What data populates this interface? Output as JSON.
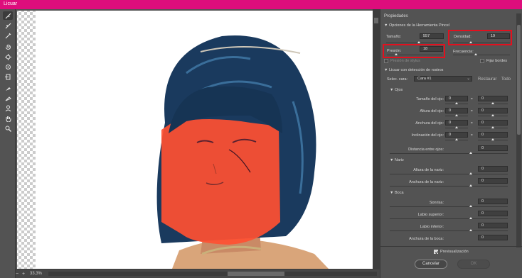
{
  "window": {
    "title": "Licuar"
  },
  "tools": [
    "warp-icon",
    "reconstruct-icon",
    "smooth-icon",
    "twirl-icon",
    "pucker-icon",
    "bloat-icon",
    "push-left-icon",
    "freeze-mask-icon",
    "thaw-mask-icon",
    "face-tool-icon",
    "hand-icon",
    "zoom-icon"
  ],
  "status": {
    "zoom": "33,3%",
    "zoom_minus": "−",
    "zoom_plus": "+"
  },
  "panel": {
    "title": "Propiedades",
    "brush": {
      "section_title": "Opciones de la Herramienta Pincel",
      "size_label": "Tamaño:",
      "size_value": "557",
      "density_label": "Densidad:",
      "density_value": "19",
      "pressure_label": "Presión:",
      "pressure_value": "18",
      "rate_label": "Frecuencia:",
      "stylus_label": "Presión de stylus",
      "pin_edges_label": "Fijar bordes"
    },
    "face": {
      "section_title": "Licuar con detección de rostros",
      "select_label": "Selec. cara:",
      "select_value": "Cara #1",
      "reset_label": "Restaurar",
      "all_label": "Todo",
      "eyes": {
        "title": "Ojos",
        "rows": [
          {
            "label": "Tamaño del ojo:",
            "left": "0",
            "right": "0"
          },
          {
            "label": "Altura del ojo:",
            "left": "0",
            "right": "0"
          },
          {
            "label": "Anchura del ojo:",
            "left": "0",
            "right": "0"
          },
          {
            "label": "Inclinación del ojo:",
            "left": "0",
            "right": "0"
          }
        ],
        "distance_label": "Distancia entre ojos:",
        "distance_value": "0"
      },
      "nose": {
        "title": "Nariz",
        "rows": [
          {
            "label": "Altura de la nariz:",
            "value": "0"
          },
          {
            "label": "Anchura de la nariz:",
            "value": "0"
          }
        ]
      },
      "mouth": {
        "title": "Boca",
        "rows": [
          {
            "label": "Sonrisa:",
            "value": "0"
          },
          {
            "label": "Labio superior:",
            "value": "0"
          },
          {
            "label": "Labio inferior:",
            "value": "0"
          },
          {
            "label": "Anchura de la boca:",
            "value": "0"
          }
        ]
      }
    },
    "preview_label": "Previsualización",
    "cancel_label": "Cancelar",
    "ok_label": "OK"
  },
  "colors": {
    "title_bar": "#de0d7c",
    "highlight_box": "#e3101e",
    "mask_overlay": "#ff5032",
    "hair": "#1a3a5e"
  }
}
